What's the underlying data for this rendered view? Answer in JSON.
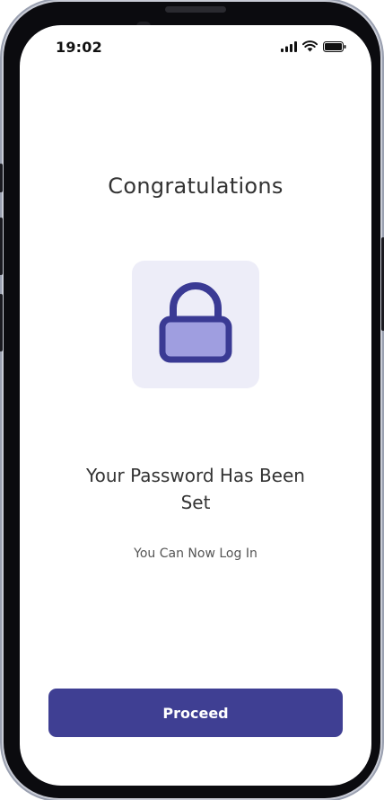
{
  "status_bar": {
    "time": "19:02",
    "icons": [
      "signal-icon",
      "wifi-icon",
      "battery-icon"
    ]
  },
  "content": {
    "title": "Congratulations",
    "illustration_icon": "lock-icon",
    "headline": "Your Password Has Been Set",
    "subtext": "You Can Now Log In"
  },
  "actions": {
    "proceed_label": "Proceed"
  },
  "colors": {
    "primary": "#3f3f93",
    "lock_tile_bg": "#ededf8",
    "lock_body_fill": "#9f9ee0",
    "lock_outline": "#3a3a94",
    "text_dark": "#333333",
    "text_muted": "#555555"
  }
}
